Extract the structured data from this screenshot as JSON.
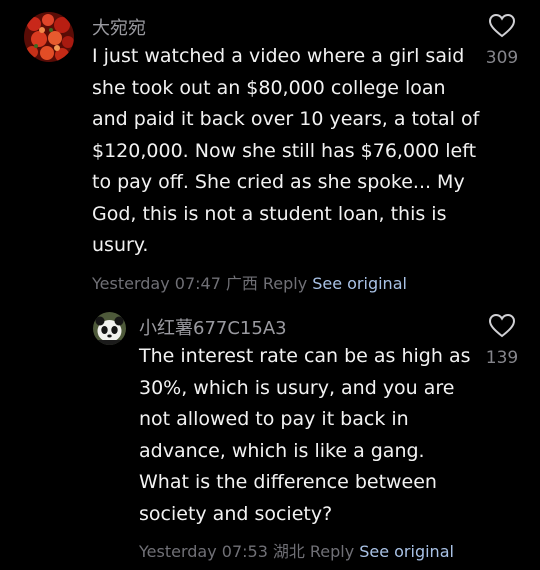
{
  "comments": [
    {
      "username": "大宛宛",
      "text": "I just watched a video where a girl said she took out an $80,000 college loan and paid it back over 10 years, a total of $120,000. Now she still has $76,000 left to pay off. She cried as she spoke... My God, this is not a student loan, this is usury.",
      "time": "Yesterday 07:47",
      "location": "广西",
      "reply_label": "Reply",
      "see_original_label": "See original",
      "like_count": "309",
      "avatar_icon": "red-flowers-avatar"
    },
    {
      "username": "小红薯677C15A3",
      "text": "The interest rate can be as high as 30%, which is usury, and you are not allowed to pay it back in advance, which is like a gang. What is the difference between society and society?",
      "time": "Yesterday 07:53",
      "location": "湖北",
      "reply_label": "Reply",
      "see_original_label": "See original",
      "like_count": "139",
      "avatar_icon": "panda-avatar"
    }
  ],
  "colors": {
    "background": "#000000",
    "text": "#f2f2f2",
    "muted": "#707076",
    "link": "#a9c2e6"
  }
}
